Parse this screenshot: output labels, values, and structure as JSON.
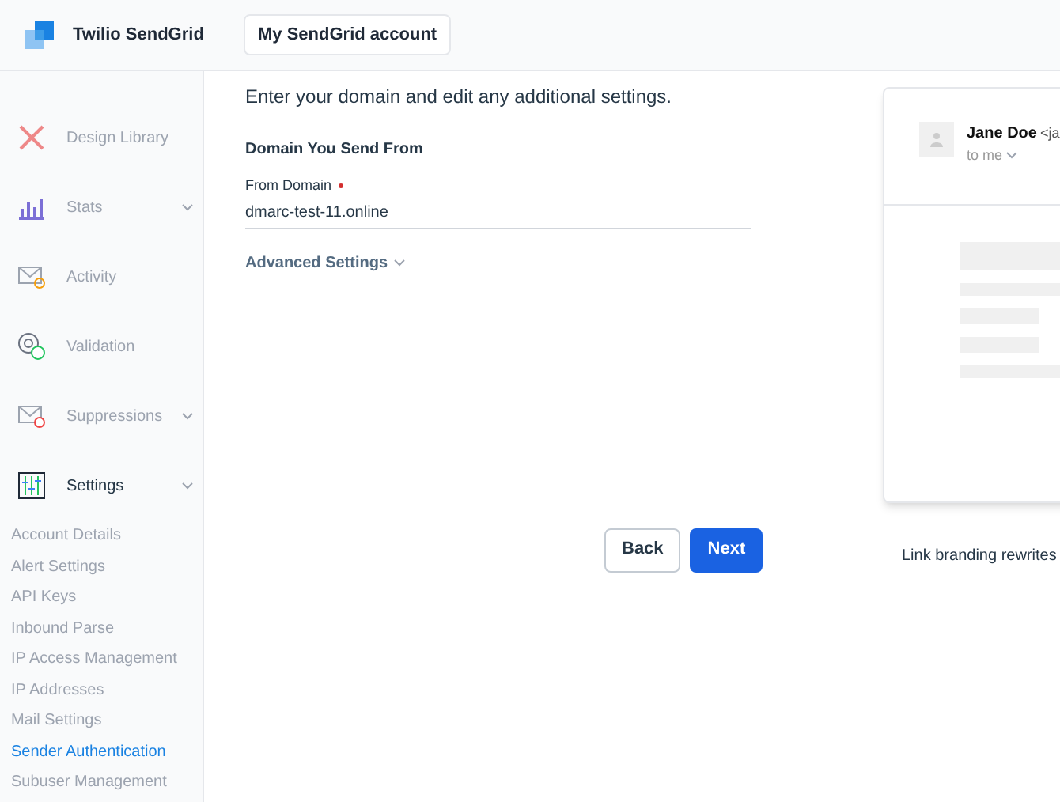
{
  "header": {
    "brand": "Twilio SendGrid",
    "account_button": "My SendGrid account"
  },
  "sidebar": {
    "items": [
      {
        "label": "Design Library",
        "kind": "design",
        "expandable": false
      },
      {
        "label": "Stats",
        "kind": "stats",
        "expandable": true
      },
      {
        "label": "Activity",
        "kind": "activity",
        "expandable": false
      },
      {
        "label": "Validation",
        "kind": "validation",
        "expandable": false
      },
      {
        "label": "Suppressions",
        "kind": "suppressions",
        "expandable": true
      },
      {
        "label": "Settings",
        "kind": "settings",
        "expandable": true,
        "expanded": true,
        "children": [
          {
            "label": "Account Details",
            "selected": false
          },
          {
            "label": "Alert Settings",
            "selected": false
          },
          {
            "label": "API Keys",
            "selected": false
          },
          {
            "label": "Inbound Parse",
            "selected": false
          },
          {
            "label": "IP Access Management",
            "selected": false
          },
          {
            "label": "IP Addresses",
            "selected": false
          },
          {
            "label": "Mail Settings",
            "selected": false
          },
          {
            "label": "Sender Authentication",
            "selected": true
          },
          {
            "label": "Subuser Management",
            "selected": false
          }
        ]
      }
    ]
  },
  "form": {
    "intro": "Enter your domain and edit any additional settings.",
    "section_title": "Domain You Send From",
    "field": {
      "label": "From Domain",
      "required": true,
      "value": "dmarc-test-11.online"
    },
    "advanced": "Advanced Settings",
    "buttons": [
      {
        "label": "Back",
        "kind": "secondary"
      },
      {
        "label": "Next",
        "kind": "primary"
      }
    ]
  },
  "preview": {
    "sender": "Jane Doe",
    "sender_email": "<ja",
    "recipient": "to me",
    "caption": "Link branding rewrites"
  }
}
